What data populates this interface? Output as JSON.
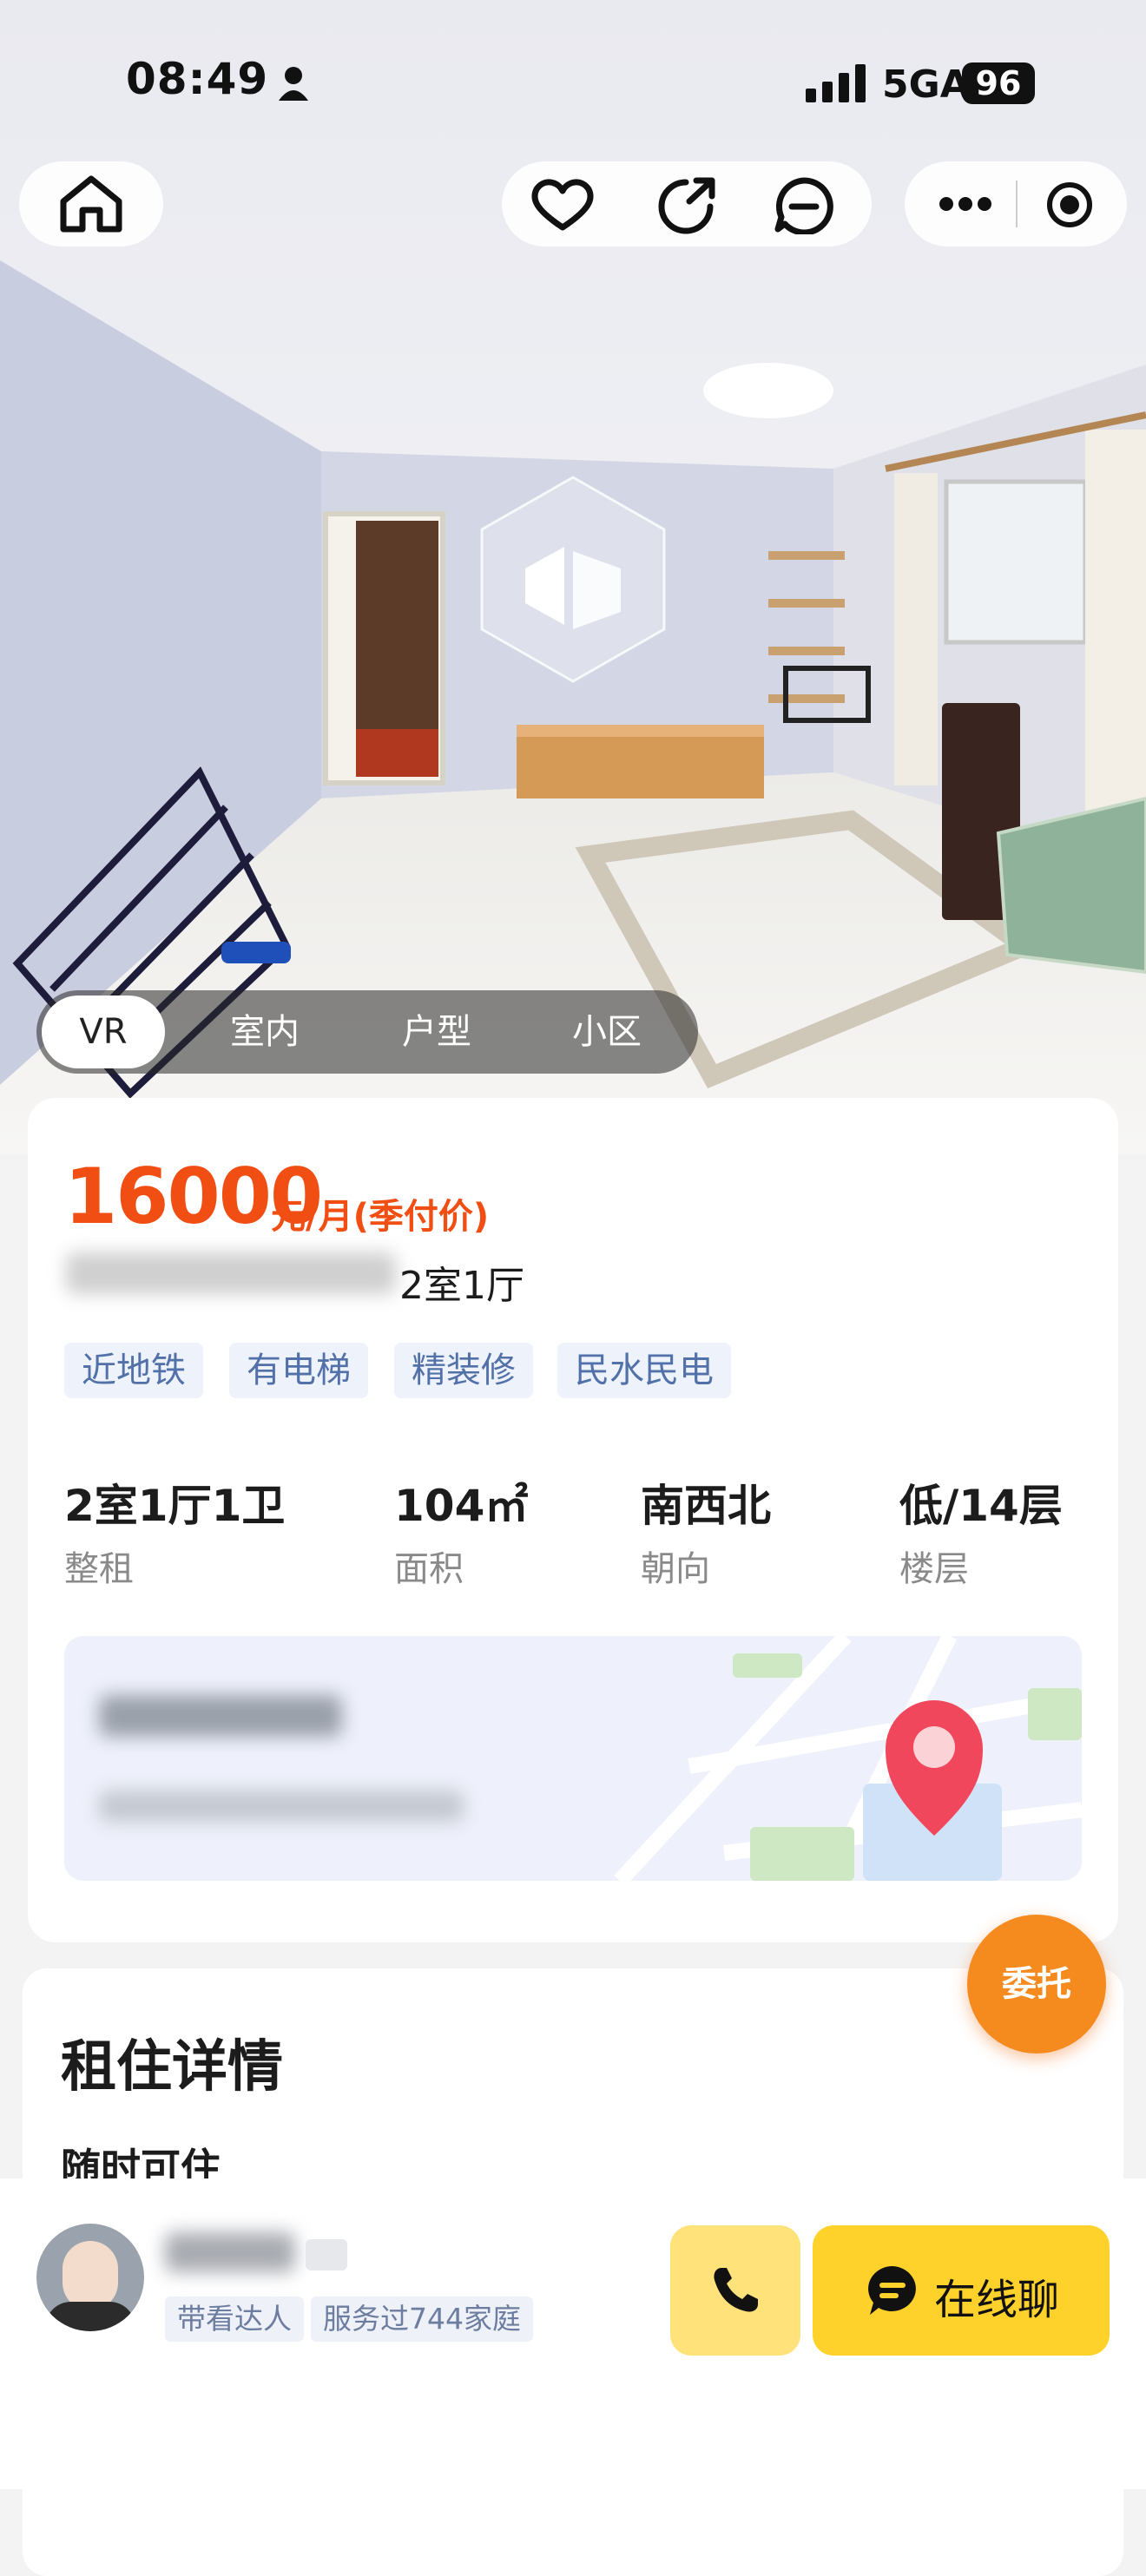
{
  "status_bar": {
    "time": "08:49",
    "network": "5GA",
    "battery": "96"
  },
  "nav": {
    "home_icon": "home-icon",
    "favorite_icon": "heart-icon",
    "share_icon": "share-icon",
    "message_icon": "message-icon",
    "more_icon": "more-icon",
    "close_icon": "target-icon"
  },
  "media_tabs": [
    "VR",
    "室内",
    "户型",
    "小区"
  ],
  "listing": {
    "price": "16000",
    "price_unit": "元/月(季付价)",
    "title_suffix": "2室1厅",
    "tags": [
      "近地铁",
      "有电梯",
      "精装修",
      "民水民电"
    ],
    "stats": [
      {
        "value": "2室1厅1卫",
        "label": "整租"
      },
      {
        "value": "104㎡",
        "label": "面积"
      },
      {
        "value": "南西北",
        "label": "朝向"
      },
      {
        "value": "低/14层",
        "label": "楼层"
      }
    ]
  },
  "float_button": "委托",
  "details": {
    "heading": "租住详情",
    "first_item": "随时可住"
  },
  "agent": {
    "badges": [
      "带看达人",
      "服务过744家庭"
    ]
  },
  "actions": {
    "chat_label": "在线聊"
  },
  "colors": {
    "accent_orange": "#f04e12",
    "cta_yellow": "#ffd22b",
    "call_yellow": "#ffe27a"
  }
}
